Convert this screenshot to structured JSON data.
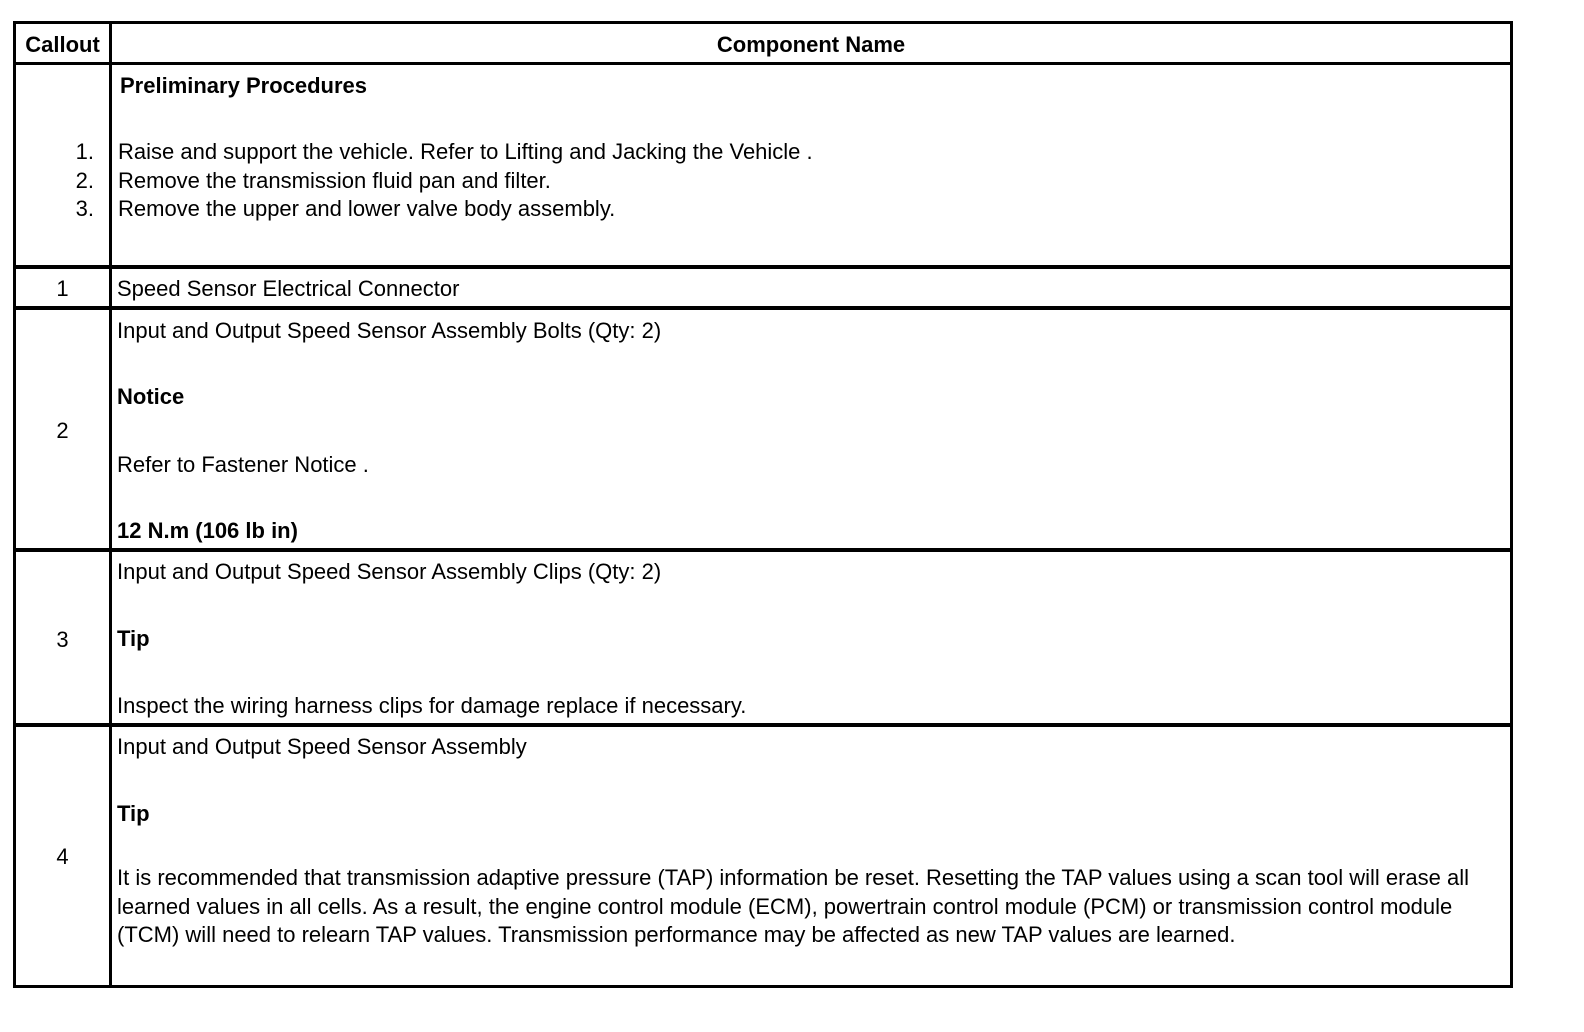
{
  "header": {
    "callout": "Callout",
    "component": "Component Name"
  },
  "preliminary": {
    "title": "Preliminary Procedures",
    "steps": [
      {
        "num": "1.",
        "text": "Raise and support the vehicle. Refer to Lifting and Jacking the Vehicle ."
      },
      {
        "num": "2.",
        "text": "Remove the transmission fluid pan and filter."
      },
      {
        "num": "3.",
        "text": "Remove the upper and lower valve body assembly."
      }
    ]
  },
  "rows": [
    {
      "callout": "1",
      "name": "Speed Sensor Electrical Connector"
    },
    {
      "callout": "2",
      "name": "Input and Output Speed Sensor Assembly Bolts (Qty: 2)",
      "note_label": "Notice",
      "note_text": "Refer to Fastener Notice .",
      "torque": "12 N.m (106 lb in)"
    },
    {
      "callout": "3",
      "name": "Input and Output Speed Sensor Assembly Clips (Qty: 2)",
      "note_label": "Tip",
      "note_text": "Inspect the wiring harness clips for damage replace if necessary."
    },
    {
      "callout": "4",
      "name": "Input and Output Speed Sensor Assembly",
      "note_label": "Tip",
      "note_text": "It is recommended that transmission adaptive pressure (TAP) information be reset. Resetting the TAP values using a scan tool will erase all learned values in all cells. As a result, the engine control module (ECM), powertrain control module (PCM) or transmission control module (TCM) will need to relearn TAP values. Transmission performance may be affected as new TAP values are learned."
    }
  ]
}
